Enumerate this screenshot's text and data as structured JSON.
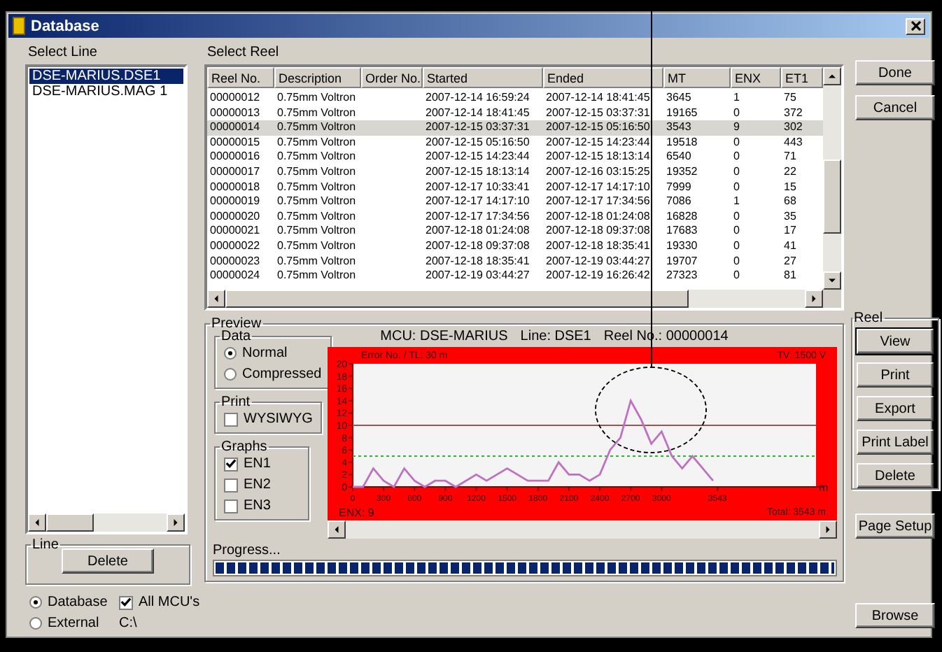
{
  "window": {
    "title": "Database"
  },
  "select_line": {
    "label": "Select Line",
    "items": [
      {
        "label": "DSE-MARIUS.DSE1",
        "selected": true
      },
      {
        "label": "DSE-MARIUS.MAG 1",
        "selected": false
      }
    ]
  },
  "line_group": {
    "title": "Line",
    "button": "Delete"
  },
  "source": {
    "options": [
      {
        "label": "Database",
        "selected": true
      },
      {
        "label": "External",
        "selected": false
      }
    ],
    "all_mcus": {
      "label": "All MCU's",
      "checked": true
    },
    "path": "C:\\"
  },
  "select_reel": {
    "label": "Select Reel",
    "columns": [
      "Reel No.",
      "Description",
      "Order No.",
      "Started",
      "Ended",
      "MT",
      "ENX",
      "ET1"
    ],
    "rows": [
      {
        "reel_no": "00000012",
        "description": "0.75mm Voltron",
        "started": "2007-12-14 16:59:24",
        "ended": "2007-12-14 18:41:45",
        "mt": "3645",
        "enx": "1",
        "et1": "75",
        "selected": false
      },
      {
        "reel_no": "00000013",
        "description": "0.75mm Voltron",
        "started": "2007-12-14 18:41:45",
        "ended": "2007-12-15 03:37:31",
        "mt": "19165",
        "enx": "0",
        "et1": "372",
        "selected": false
      },
      {
        "reel_no": "00000014",
        "description": "0.75mm Voltron",
        "started": "2007-12-15 03:37:31",
        "ended": "2007-12-15 05:16:50",
        "mt": "3543",
        "enx": "9",
        "et1": "302",
        "selected": true
      },
      {
        "reel_no": "00000015",
        "description": "0.75mm Voltron",
        "started": "2007-12-15 05:16:50",
        "ended": "2007-12-15 14:23:44",
        "mt": "19518",
        "enx": "0",
        "et1": "443",
        "selected": false
      },
      {
        "reel_no": "00000016",
        "description": "0.75mm Voltron",
        "started": "2007-12-15 14:23:44",
        "ended": "2007-12-15 18:13:14",
        "mt": "6540",
        "enx": "0",
        "et1": "71",
        "selected": false
      },
      {
        "reel_no": "00000017",
        "description": "0.75mm Voltron",
        "started": "2007-12-15 18:13:14",
        "ended": "2007-12-16 03:15:25",
        "mt": "19352",
        "enx": "0",
        "et1": "22",
        "selected": false
      },
      {
        "reel_no": "00000018",
        "description": "0.75mm Voltron",
        "started": "2007-12-17 10:33:41",
        "ended": "2007-12-17 14:17:10",
        "mt": "7999",
        "enx": "0",
        "et1": "15",
        "selected": false
      },
      {
        "reel_no": "00000019",
        "description": "0.75mm Voltron",
        "started": "2007-12-17 14:17:10",
        "ended": "2007-12-17 17:34:56",
        "mt": "7086",
        "enx": "1",
        "et1": "68",
        "selected": false
      },
      {
        "reel_no": "00000020",
        "description": "0.75mm Voltron",
        "started": "2007-12-17 17:34:56",
        "ended": "2007-12-18 01:24:08",
        "mt": "16828",
        "enx": "0",
        "et1": "35",
        "selected": false
      },
      {
        "reel_no": "00000021",
        "description": "0.75mm Voltron",
        "started": "2007-12-18 01:24:08",
        "ended": "2007-12-18 09:37:08",
        "mt": "17683",
        "enx": "0",
        "et1": "17",
        "selected": false
      },
      {
        "reel_no": "00000022",
        "description": "0.75mm Voltron",
        "started": "2007-12-18 09:37:08",
        "ended": "2007-12-18 18:35:41",
        "mt": "19330",
        "enx": "0",
        "et1": "41",
        "selected": false
      },
      {
        "reel_no": "00000023",
        "description": "0.75mm Voltron",
        "started": "2007-12-18 18:35:41",
        "ended": "2007-12-19 03:44:27",
        "mt": "19707",
        "enx": "0",
        "et1": "27",
        "selected": false
      },
      {
        "reel_no": "00000024",
        "description": "0.75mm Voltron",
        "started": "2007-12-19 03:44:27",
        "ended": "2007-12-19 16:26:42",
        "mt": "27323",
        "enx": "0",
        "et1": "81",
        "selected": false
      }
    ]
  },
  "preview": {
    "title": "Preview",
    "data_group": {
      "title": "Data",
      "options": [
        {
          "label": "Normal",
          "selected": true
        },
        {
          "label": "Compressed",
          "selected": false
        }
      ]
    },
    "print_group": {
      "title": "Print",
      "options": [
        {
          "label": "WYSIWYG",
          "checked": false
        }
      ]
    },
    "graphs_group": {
      "title": "Graphs",
      "options": [
        {
          "label": "EN1",
          "checked": true
        },
        {
          "label": "EN2",
          "checked": false
        },
        {
          "label": "EN3",
          "checked": false
        }
      ]
    },
    "info": [
      "MCU: DSE-MARIUS",
      "Line: DSE1",
      "Reel No.: 00000014"
    ],
    "chart": {
      "header_left": "Error No. / TL: 30 m",
      "header_right": "TV: 1500 V",
      "footer_left": "ENX: 9",
      "footer_right": "Total: 3543 m",
      "chart_data": {
        "type": "line",
        "xlabel": "m",
        "xlim": [
          0,
          4500
        ],
        "ylim": [
          0,
          20
        ],
        "xticks": [
          0,
          300,
          600,
          900,
          1200,
          1500,
          1800,
          2100,
          2400,
          2700,
          3000,
          3543
        ],
        "yticks": [
          0,
          2,
          4,
          6,
          8,
          10,
          12,
          14,
          16,
          18,
          20
        ],
        "x": [
          0,
          100,
          200,
          300,
          400,
          500,
          600,
          700,
          800,
          900,
          1000,
          1100,
          1200,
          1300,
          1400,
          1500,
          1600,
          1700,
          1800,
          1900,
          2000,
          2100,
          2200,
          2300,
          2400,
          2500,
          2600,
          2700,
          2800,
          2900,
          3000,
          3100,
          3200,
          3300,
          3400,
          3500
        ],
        "series": [
          {
            "color": "#c070c0",
            "values": [
              0,
              0,
              3,
              1,
              0,
              3,
              1,
              0,
              1,
              1,
              0,
              1,
              2,
              1,
              2,
              3,
              2,
              1,
              1,
              1,
              4,
              2,
              2,
              1,
              2,
              6,
              8,
              14,
              11,
              7,
              9,
              5,
              3,
              5,
              3,
              1
            ]
          }
        ],
        "ref_lines": [
          {
            "axis": "y",
            "value": 10,
            "color": "#a05050"
          },
          {
            "axis": "y",
            "value": 5,
            "color": "#20c020"
          }
        ]
      }
    },
    "progress": {
      "label": "Progress...",
      "level": 1
    }
  },
  "top_buttons": [
    {
      "label": "Done",
      "focused": false
    },
    {
      "label": "Cancel",
      "focused": false
    }
  ],
  "reel_group": {
    "title": "Reel",
    "buttons": [
      {
        "label": "View",
        "focused": true
      },
      {
        "label": "Print",
        "focused": false
      },
      {
        "label": "Export",
        "focused": false
      },
      {
        "label": "Print Label",
        "focused": false
      },
      {
        "label": "Delete",
        "focused": false
      }
    ]
  },
  "page_setup": {
    "label": "Page Setup"
  },
  "browse": {
    "label": "Browse"
  }
}
